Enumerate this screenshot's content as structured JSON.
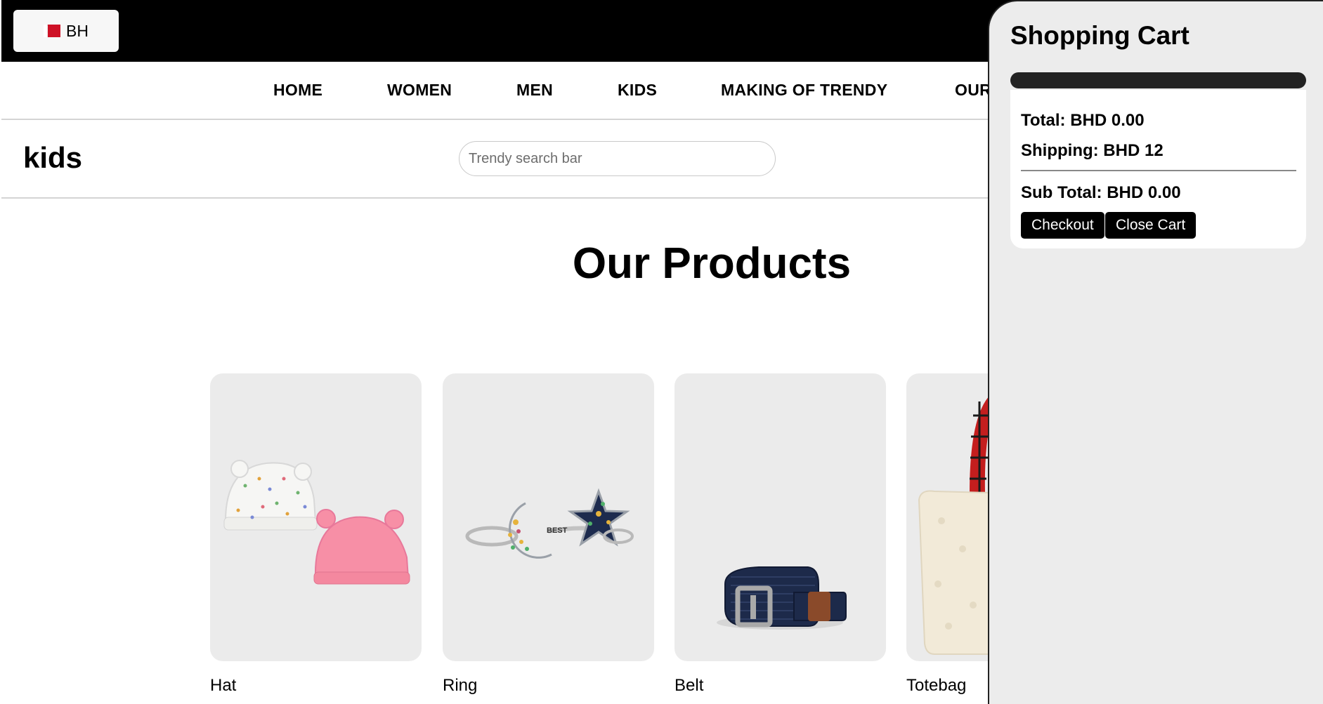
{
  "topbar": {
    "country_code": "BH",
    "flag_icon": "bahrain-flag-icon"
  },
  "nav": {
    "items": [
      "HOME",
      "WOMEN",
      "MEN",
      "KIDS",
      "MAKING OF TRENDY",
      "OUR"
    ]
  },
  "header": {
    "page_title": "kids",
    "search_placeholder": "Trendy search bar",
    "search_value": ""
  },
  "products": {
    "title": "Our Products",
    "items": [
      {
        "name": "Hat",
        "image_icon": "baby-hats-image"
      },
      {
        "name": "Ring",
        "image_icon": "moon-star-rings-image"
      },
      {
        "name": "Belt",
        "image_icon": "woven-belt-image"
      },
      {
        "name": "Totebag",
        "image_icon": "sherpa-tote-bag-image"
      }
    ]
  },
  "cart": {
    "title": "Shopping Cart",
    "total": "Total: BHD 0.00",
    "shipping": "Shipping: BHD 12",
    "subtotal": "Sub Total: BHD 0.00",
    "checkout_label": "Checkout",
    "close_label": "Close Cart"
  },
  "colors": {
    "topbar": "#000000",
    "cart_background": "#ececec",
    "card_background": "#ebebeb",
    "button": "#000000",
    "flag_red": "#ce1126"
  }
}
